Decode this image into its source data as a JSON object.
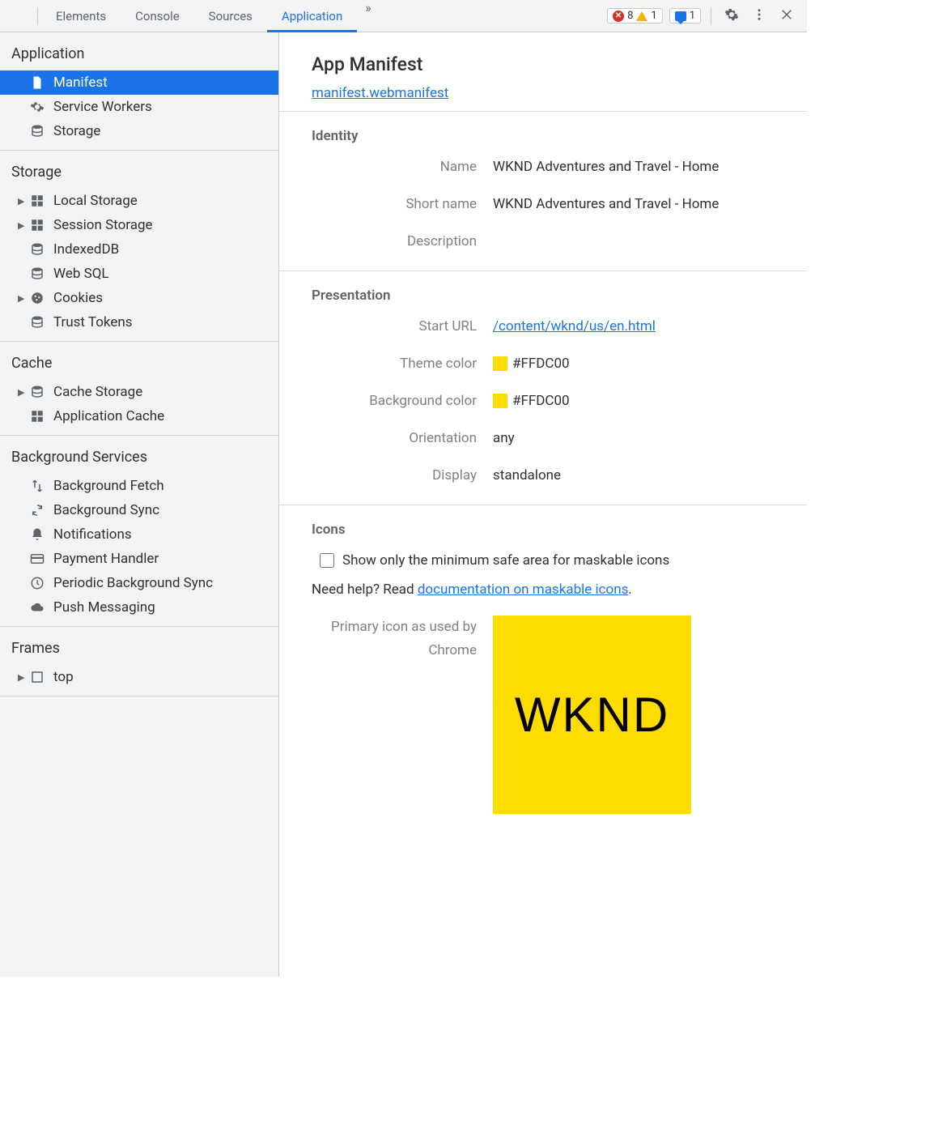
{
  "toolbar": {
    "tabs": [
      "Elements",
      "Console",
      "Sources",
      "Application"
    ],
    "active_tab": "Application",
    "error_count": "8",
    "warn_count": "1",
    "msg_count": "1"
  },
  "sidebar": {
    "groups": [
      {
        "title": "Application",
        "items": [
          {
            "id": "manifest",
            "icon": "file",
            "label": "Manifest",
            "selected": true,
            "expandable": false
          },
          {
            "id": "sw",
            "icon": "gear",
            "label": "Service Workers",
            "selected": false,
            "expandable": false
          },
          {
            "id": "storage-app",
            "icon": "db",
            "label": "Storage",
            "selected": false,
            "expandable": false
          }
        ]
      },
      {
        "title": "Storage",
        "items": [
          {
            "id": "local",
            "icon": "grid",
            "label": "Local Storage",
            "expandable": true
          },
          {
            "id": "session",
            "icon": "grid",
            "label": "Session Storage",
            "expandable": true
          },
          {
            "id": "idb",
            "icon": "db",
            "label": "IndexedDB",
            "expandable": false
          },
          {
            "id": "websql",
            "icon": "db",
            "label": "Web SQL",
            "expandable": false
          },
          {
            "id": "cookies",
            "icon": "cookie",
            "label": "Cookies",
            "expandable": true
          },
          {
            "id": "trust",
            "icon": "db",
            "label": "Trust Tokens",
            "expandable": false
          }
        ]
      },
      {
        "title": "Cache",
        "items": [
          {
            "id": "cachestore",
            "icon": "db",
            "label": "Cache Storage",
            "expandable": true
          },
          {
            "id": "appcache",
            "icon": "grid",
            "label": "Application Cache",
            "expandable": false
          }
        ]
      },
      {
        "title": "Background Services",
        "items": [
          {
            "id": "bgfetch",
            "icon": "updown",
            "label": "Background Fetch",
            "expandable": false
          },
          {
            "id": "bgsync",
            "icon": "sync",
            "label": "Background Sync",
            "expandable": false
          },
          {
            "id": "notif",
            "icon": "bell",
            "label": "Notifications",
            "expandable": false
          },
          {
            "id": "pay",
            "icon": "card",
            "label": "Payment Handler",
            "expandable": false
          },
          {
            "id": "periodic",
            "icon": "clock",
            "label": "Periodic Background Sync",
            "expandable": false
          },
          {
            "id": "push",
            "icon": "cloud",
            "label": "Push Messaging",
            "expandable": false
          }
        ]
      },
      {
        "title": "Frames",
        "items": [
          {
            "id": "top",
            "icon": "frame",
            "label": "top",
            "expandable": true
          }
        ]
      }
    ]
  },
  "content": {
    "title": "App Manifest",
    "manifest_link": "manifest.webmanifest",
    "identity": {
      "heading": "Identity",
      "name_key": "Name",
      "name_val": "WKND Adventures and Travel - Home",
      "short_key": "Short name",
      "short_val": "WKND Adventures and Travel - Home",
      "desc_key": "Description",
      "desc_val": ""
    },
    "presentation": {
      "heading": "Presentation",
      "start_key": "Start URL",
      "start_val": "/content/wknd/us/en.html",
      "theme_key": "Theme color",
      "theme_val": "#FFDC00",
      "theme_swatch": "#FFDC00",
      "bg_key": "Background color",
      "bg_val": "#FFDC00",
      "bg_swatch": "#FFDC00",
      "orient_key": "Orientation",
      "orient_val": "any",
      "display_key": "Display",
      "display_val": "standalone"
    },
    "icons": {
      "heading": "Icons",
      "checkbox_label": "Show only the minimum safe area for maskable icons",
      "help_prefix": "Need help? Read ",
      "help_link": "documentation on maskable icons",
      "help_suffix": ".",
      "primary_label_line1": "Primary icon as used by",
      "primary_label_line2": "Chrome",
      "icon_text": "WKND",
      "icon_bg": "#ffdc00"
    }
  }
}
